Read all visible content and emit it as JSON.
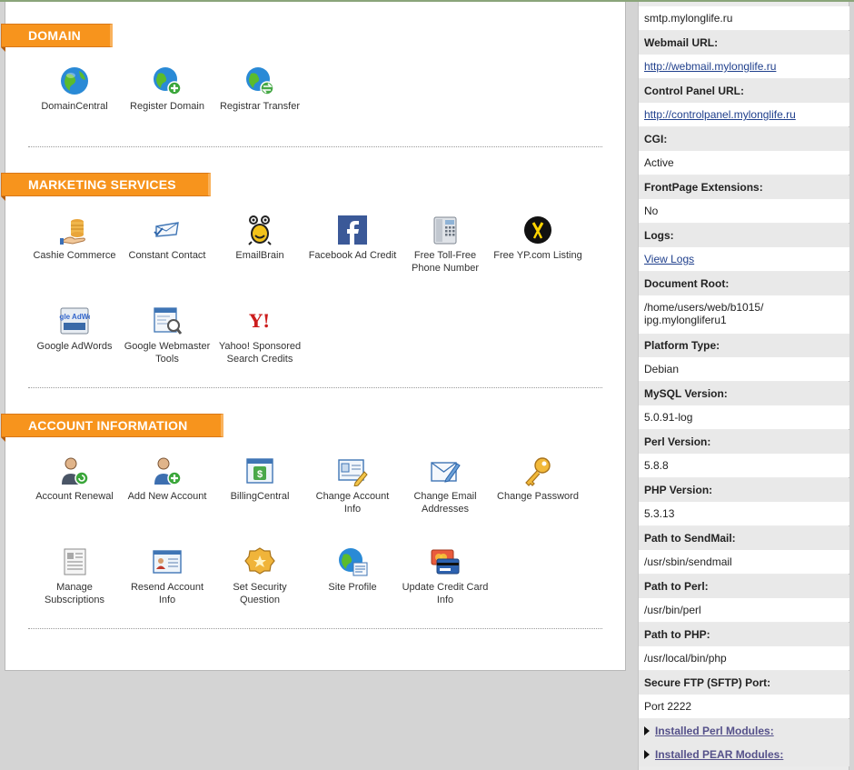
{
  "domain": {
    "title": "DOMAIN",
    "items": [
      {
        "label": "DomainCentral"
      },
      {
        "label": "Register Domain"
      },
      {
        "label": "Registrar Transfer"
      }
    ]
  },
  "marketing": {
    "title": "MARKETING SERVICES",
    "items": [
      {
        "label": "Cashie Commerce"
      },
      {
        "label": "Constant Contact"
      },
      {
        "label": "EmailBrain"
      },
      {
        "label": "Facebook Ad Credit"
      },
      {
        "label": "Free Toll-Free Phone Number"
      },
      {
        "label": "Free YP.com Listing"
      },
      {
        "label": "Google AdWords"
      },
      {
        "label": "Google Webmaster Tools"
      },
      {
        "label": "Yahoo! Sponsored Search Credits"
      }
    ]
  },
  "account": {
    "title": "ACCOUNT INFORMATION",
    "items": [
      {
        "label": "Account Renewal"
      },
      {
        "label": "Add New Account"
      },
      {
        "label": "BillingCentral"
      },
      {
        "label": "Change Account Info"
      },
      {
        "label": "Change Email Addresses"
      },
      {
        "label": "Change Password"
      },
      {
        "label": "Manage Subscriptions"
      },
      {
        "label": "Resend Account Info"
      },
      {
        "label": "Set Security Question"
      },
      {
        "label": "Site Profile"
      },
      {
        "label": "Update Credit Card Info"
      }
    ]
  },
  "icon_text": {
    "google_adwords": "Google AdWords",
    "yahoo": "Y!"
  },
  "info": {
    "smtp_value": "smtp.mylonglife.ru",
    "webmail_label": "Webmail URL:",
    "webmail_value": "http://webmail.mylonglife.ru",
    "cp_label": "Control Panel URL:",
    "cp_value": "http://controlpanel.mylonglife.ru",
    "cgi_label": "CGI:",
    "cgi_value": "Active",
    "fp_label": "FrontPage Extensions:",
    "fp_value": "No",
    "logs_label": "Logs:",
    "logs_value": "View Logs",
    "docroot_label": "Document Root:",
    "docroot_value_1": "/home/users/web/b1015/",
    "docroot_value_2": "ipg.mylongliferu1",
    "platform_label": "Platform Type:",
    "platform_value": "Debian",
    "mysql_label": "MySQL Version:",
    "mysql_value": "5.0.91-log",
    "perl_label": "Perl Version:",
    "perl_value": "5.8.8",
    "php_label": "PHP Version:",
    "php_value": "5.3.13",
    "sendmail_label": "Path to SendMail:",
    "sendmail_value": "/usr/sbin/sendmail",
    "pathperl_label": "Path to Perl:",
    "pathperl_value": "/usr/bin/perl",
    "pathphp_label": "Path to PHP:",
    "pathphp_value": "/usr/local/bin/php",
    "sftp_label": "Secure FTP (SFTP) Port:",
    "sftp_value": "Port 2222",
    "perl_modules_link": "Installed Perl Modules:",
    "pear_modules_link": "Installed PEAR Modules:"
  },
  "colors": {
    "accent_orange": "#f7941d",
    "link_blue": "#1f3f8c",
    "expander_purple": "#55518a"
  }
}
